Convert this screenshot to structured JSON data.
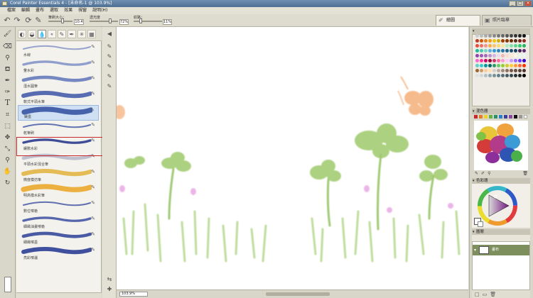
{
  "window": {
    "title": "Corel Painter Essentials 4 - [未命名-1 @ 103.9%]",
    "buttons": [
      "_",
      "□",
      "×"
    ]
  },
  "menu": [
    "檔案",
    "編輯",
    "畫布",
    "選取",
    "效果",
    "視窗",
    "說明(H)"
  ],
  "properties": {
    "size_label": "筆刷大小：",
    "size_value": "10.4",
    "opacity_label": "透光度",
    "opacity_value": "72%",
    "grain_label": "紋路：",
    "grain_value": "11%"
  },
  "modes": {
    "paint": "繪圖",
    "auto_paint": "照片臨摹"
  },
  "brush_variants": [
    {
      "label": "水線",
      "color": "#8a95c9"
    },
    {
      "label": "暈水彩",
      "color": "#7d8fc6"
    },
    {
      "label": "溼水圓筆",
      "color": "#5d74b8"
    },
    {
      "label": "軟式平頭水筆",
      "color": "#3b55a6"
    },
    {
      "label": "鑲墨",
      "color": "#2d4b9c",
      "selected": true
    },
    {
      "label": "乾筆刷",
      "color": "#4a5ea8"
    },
    {
      "label": "鑲數水彩",
      "color": "#1e2f86"
    },
    {
      "label": "平頭水彩混合筆",
      "color": "#b4b7c8"
    },
    {
      "label": "微度模仿筆",
      "color": "#e2b23a"
    },
    {
      "label": "明高模水彩筆",
      "color": "#e9a520"
    },
    {
      "label": "數位噴槍",
      "color": "#475aa5"
    },
    {
      "label": "細緻油畫噴槍",
      "color": "#3a4ea0"
    },
    {
      "label": "細緻噴墨",
      "color": "#2c4196"
    },
    {
      "label": "亮彩噴灑",
      "color": "#1f3490"
    }
  ],
  "panels": {
    "colors_title": "",
    "mixer_title": "混色器",
    "color_set_title": "色彩環",
    "layers_title": "圖層"
  },
  "layer": {
    "name": "畫布"
  },
  "canvas_zoom": "103.9%",
  "colors": {
    "selected_highlight": "#c8282b",
    "layer_selected": "#7d8f5d"
  }
}
